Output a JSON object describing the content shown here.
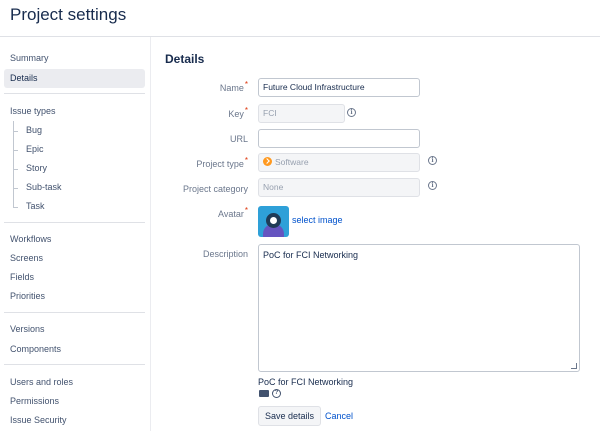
{
  "header": {
    "title": "Project settings"
  },
  "sidebar": {
    "summary": "Summary",
    "details": "Details",
    "issue_types": "Issue types",
    "issue_type_items": [
      "Bug",
      "Epic",
      "Story",
      "Sub-task",
      "Task"
    ],
    "workflows": "Workflows",
    "screens": "Screens",
    "fields": "Fields",
    "priorities": "Priorities",
    "versions": "Versions",
    "components": "Components",
    "users_and_roles": "Users and roles",
    "permissions": "Permissions",
    "issue_security": "Issue Security"
  },
  "main": {
    "section_title": "Details",
    "fields": {
      "name": {
        "label": "Name",
        "value": "Future Cloud Infrastructure",
        "required": true
      },
      "key": {
        "label": "Key",
        "value": "FCI",
        "required": true
      },
      "url": {
        "label": "URL",
        "value": ""
      },
      "project_type": {
        "label": "Project type",
        "value": "Software",
        "required": true
      },
      "project_category": {
        "label": "Project category",
        "value": "None"
      },
      "avatar": {
        "label": "Avatar",
        "link": "select image",
        "required": true
      },
      "description": {
        "label": "Description",
        "value": "PoC for FCI Networking"
      }
    },
    "preview_text": "PoC for FCI Networking",
    "save_label": "Save details",
    "cancel_label": "Cancel",
    "required_mark": "*",
    "info_glyph": "i",
    "help_glyph": "?"
  },
  "colors": {
    "accent": "#0052cc",
    "required": "#de350b",
    "software_icon": "#ff991f",
    "avatar_bg": "#2ea0d8"
  },
  "icons": [
    "info-icon",
    "software-icon",
    "avatar-image",
    "wiki-markup-icon",
    "help-icon"
  ]
}
